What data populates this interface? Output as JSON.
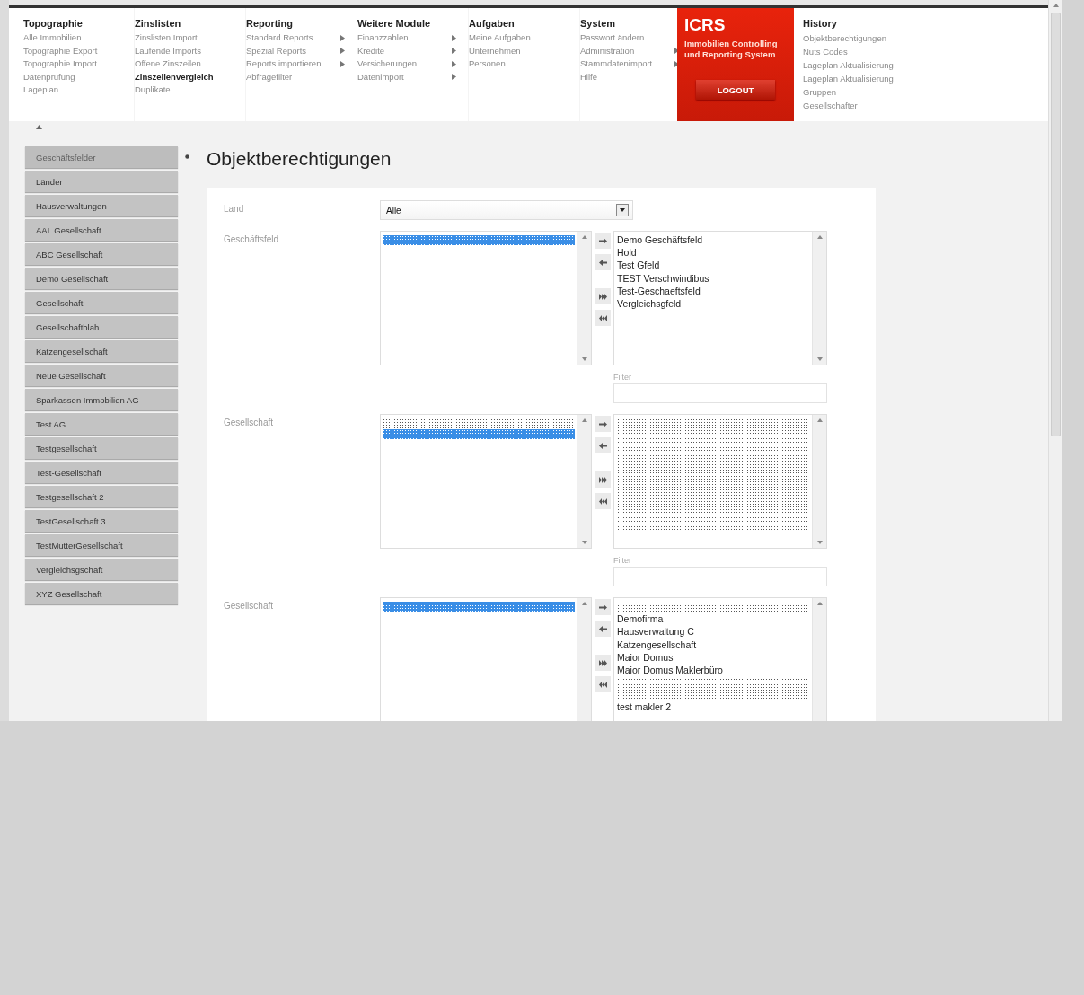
{
  "nav": {
    "menus": [
      {
        "title": "Topographie",
        "items": [
          {
            "label": "Alle Immobilien",
            "submenu": false,
            "selected": false
          },
          {
            "label": "Topographie Export",
            "submenu": false,
            "selected": false
          },
          {
            "label": "Topographie Import",
            "submenu": false,
            "selected": false
          },
          {
            "label": "Datenprüfung",
            "submenu": false,
            "selected": false
          },
          {
            "label": "Lageplan",
            "submenu": false,
            "selected": false
          }
        ]
      },
      {
        "title": "Zinslisten",
        "items": [
          {
            "label": "Zinslisten Import",
            "submenu": false,
            "selected": false
          },
          {
            "label": "Laufende Imports",
            "submenu": false,
            "selected": false
          },
          {
            "label": "Offene Zinszeilen",
            "submenu": false,
            "selected": false
          },
          {
            "label": "Zinszeilenvergleich",
            "submenu": false,
            "selected": true
          },
          {
            "label": "Duplikate",
            "submenu": false,
            "selected": false
          }
        ]
      },
      {
        "title": "Reporting",
        "items": [
          {
            "label": "Standard Reports",
            "submenu": true,
            "selected": false
          },
          {
            "label": "Spezial Reports",
            "submenu": true,
            "selected": false
          },
          {
            "label": "Reports importieren",
            "submenu": true,
            "selected": false
          },
          {
            "label": "Abfragefilter",
            "submenu": false,
            "selected": false
          }
        ]
      },
      {
        "title": "Weitere Module",
        "items": [
          {
            "label": "Finanzzahlen",
            "submenu": true,
            "selected": false
          },
          {
            "label": "Kredite",
            "submenu": true,
            "selected": false
          },
          {
            "label": "Versicherungen",
            "submenu": true,
            "selected": false
          },
          {
            "label": "Datenimport",
            "submenu": true,
            "selected": false
          }
        ]
      },
      {
        "title": "Aufgaben",
        "items": [
          {
            "label": "Meine Aufgaben",
            "submenu": false,
            "selected": false
          },
          {
            "label": "Unternehmen",
            "submenu": false,
            "selected": false
          },
          {
            "label": "Personen",
            "submenu": false,
            "selected": false
          }
        ]
      },
      {
        "title": "System",
        "items": [
          {
            "label": "Passwort ändern",
            "submenu": false,
            "selected": false
          },
          {
            "label": "Administration",
            "submenu": true,
            "selected": false
          },
          {
            "label": "Stammdatenimport",
            "submenu": true,
            "selected": false
          },
          {
            "label": "Hilfe",
            "submenu": false,
            "selected": false
          }
        ]
      }
    ],
    "brand": {
      "name": "ICRS",
      "tagline": "Immobilien Controlling und Reporting System",
      "logout": "LOGOUT"
    },
    "history": {
      "title": "History",
      "items": [
        "Objektberechtigungen",
        "Nuts Codes",
        "Lageplan Aktualisierung",
        "Lageplan Aktualisierung",
        "Gruppen",
        "Gesellschafter"
      ]
    }
  },
  "sidebar": {
    "items": [
      {
        "label": "Geschäftsfelder",
        "selected": true
      },
      {
        "label": "Länder",
        "selected": false
      },
      {
        "label": "Hausverwaltungen",
        "selected": false
      },
      {
        "label": "AAL Gesellschaft",
        "selected": false
      },
      {
        "label": "ABC Gesellschaft",
        "selected": false
      },
      {
        "label": "Demo Gesellschaft",
        "selected": false
      },
      {
        "label": "Gesellschaft",
        "selected": false
      },
      {
        "label": "Gesellschaftblah",
        "selected": false
      },
      {
        "label": "Katzengesellschaft",
        "selected": false
      },
      {
        "label": "Neue Gesellschaft",
        "selected": false
      },
      {
        "label": "Sparkassen Immobilien AG",
        "selected": false
      },
      {
        "label": "Test AG",
        "selected": false
      },
      {
        "label": "Testgesellschaft",
        "selected": false
      },
      {
        "label": "Test-Gesellschaft",
        "selected": false
      },
      {
        "label": "Testgesellschaft 2",
        "selected": false
      },
      {
        "label": "TestGesellschaft 3",
        "selected": false
      },
      {
        "label": "TestMutterGesellschaft",
        "selected": false
      },
      {
        "label": "Vergleichsgschaft",
        "selected": false
      },
      {
        "label": "XYZ Gesellschaft",
        "selected": false
      }
    ]
  },
  "page_title": "Objektberechtigungen",
  "fields": [
    {
      "kind": "select",
      "label": "Land",
      "value": "Alle"
    },
    {
      "kind": "dual_list",
      "label": "Geschäftsfeld",
      "filter_label": "Filter",
      "available": [
        {
          "kind": "redacted",
          "selected": true
        }
      ],
      "assigned": [
        {
          "kind": "text",
          "label": "Demo Geschäftsfeld"
        },
        {
          "kind": "text",
          "label": "Hold"
        },
        {
          "kind": "text",
          "label": "Test Gfeld"
        },
        {
          "kind": "text",
          "label": "TEST Verschwindibus"
        },
        {
          "kind": "text",
          "label": "Test-Geschaeftsfeld"
        },
        {
          "kind": "text",
          "label": "Vergleichsgfeld"
        }
      ]
    },
    {
      "kind": "dual_list",
      "label": "Gesellschaft",
      "filter_label": "Filter",
      "available": [
        {
          "kind": "redacted",
          "selected": false
        },
        {
          "kind": "redacted",
          "selected": true
        }
      ],
      "assigned": [
        {
          "kind": "redacted"
        },
        {
          "kind": "redacted"
        },
        {
          "kind": "redacted"
        },
        {
          "kind": "redacted"
        },
        {
          "kind": "redacted"
        },
        {
          "kind": "redacted"
        },
        {
          "kind": "redacted"
        },
        {
          "kind": "redacted"
        },
        {
          "kind": "redacted"
        },
        {
          "kind": "redacted"
        }
      ]
    },
    {
      "kind": "dual_list",
      "label": "Gesellschaft",
      "available": [
        {
          "kind": "redacted",
          "selected": true
        }
      ],
      "assigned": [
        {
          "kind": "redacted"
        },
        {
          "kind": "text",
          "label": "Demofirma"
        },
        {
          "kind": "text",
          "label": "Hausverwaltung C"
        },
        {
          "kind": "text",
          "label": "Katzengesellschaft"
        },
        {
          "kind": "text",
          "label": "Maior Domus"
        },
        {
          "kind": "text",
          "label": "Maior Domus Maklerbüro"
        },
        {
          "kind": "redacted"
        },
        {
          "kind": "redacted"
        },
        {
          "kind": "text",
          "label": "test makler 2"
        }
      ]
    }
  ]
}
